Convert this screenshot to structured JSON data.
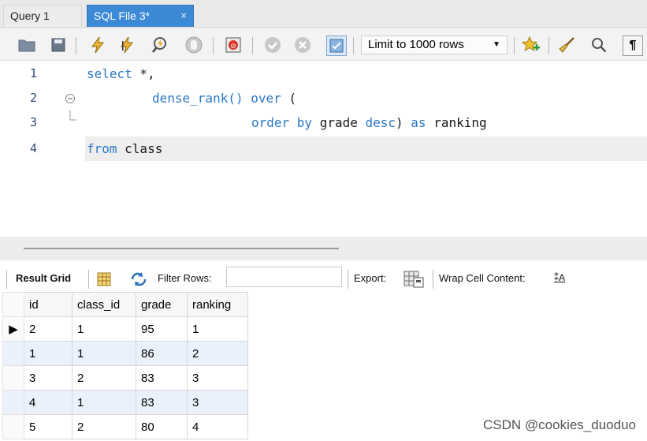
{
  "tabs": [
    {
      "label": "Query 1",
      "active": false
    },
    {
      "label": "SQL File 3*",
      "active": true,
      "close": "×"
    }
  ],
  "toolbar": {
    "limit_label": "Limit to 1000 rows",
    "limit_arrow": "▼"
  },
  "editor": {
    "lines": [
      {
        "n": "1",
        "parts": [
          {
            "t": "select",
            "k": true
          },
          {
            "t": " *,",
            "k": false
          }
        ]
      },
      {
        "n": "2",
        "parts": [
          {
            "t": "dense_rank()",
            "k": true
          },
          {
            "t": " over",
            "k": true
          },
          {
            "t": " (",
            "k": false
          }
        ]
      },
      {
        "n": "3",
        "parts": [
          {
            "t": "order by",
            "k": true
          },
          {
            "t": " grade ",
            "k": false
          },
          {
            "t": "desc",
            "k": true
          },
          {
            "t": ") ",
            "k": false
          },
          {
            "t": "as",
            "k": true
          },
          {
            "t": " ranking",
            "k": false
          }
        ]
      },
      {
        "n": "4",
        "parts": [
          {
            "t": "from",
            "k": true
          },
          {
            "t": " class",
            "k": false
          }
        ]
      }
    ]
  },
  "result_toolbar": {
    "result_grid": "Result Grid",
    "filter_rows": "Filter Rows:",
    "filter_value": "",
    "export": "Export:",
    "wrap": "Wrap Cell Content:",
    "wrap_icon_glyph": "⁑A"
  },
  "grid": {
    "columns": [
      "id",
      "class_id",
      "grade",
      "ranking"
    ],
    "rows": [
      [
        "2",
        "1",
        "95",
        "1"
      ],
      [
        "1",
        "1",
        "86",
        "2"
      ],
      [
        "3",
        "2",
        "83",
        "3"
      ],
      [
        "4",
        "1",
        "83",
        "3"
      ],
      [
        "5",
        "2",
        "80",
        "4"
      ]
    ],
    "current_row_marker": "▶"
  },
  "watermark": "CSDN @cookies_duoduo"
}
